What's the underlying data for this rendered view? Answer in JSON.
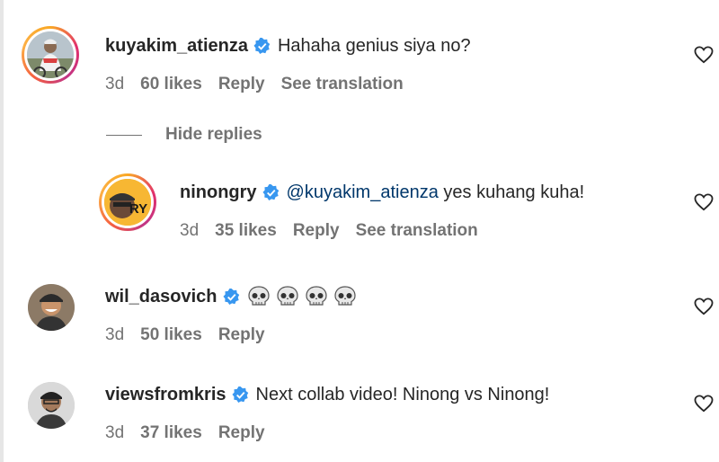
{
  "comments": [
    {
      "username": "kuyakim_atienza",
      "text": "Hahaha genius siya no?",
      "time": "3d",
      "likes": "60 likes",
      "reply": "Reply",
      "translation": "See translation"
    },
    {
      "username": "ninongry",
      "mention": "@kuyakim_atienza",
      "text": " yes kuhang kuha!",
      "time": "3d",
      "likes": "35 likes",
      "reply": "Reply",
      "translation": "See translation",
      "avatar_text": "RY"
    },
    {
      "username": "wil_dasovich",
      "text_icons": [
        "skull-icon",
        "skull-icon",
        "skull-icon",
        "skull-icon"
      ],
      "time": "3d",
      "likes": "50 likes",
      "reply": "Reply"
    },
    {
      "username": "viewsfromkris",
      "text": "Next collab video! Ninong vs Ninong!",
      "time": "3d",
      "likes": "37 likes",
      "reply": "Reply"
    }
  ],
  "hide_replies": "Hide replies",
  "colors": {
    "verified": "#3897f0",
    "meta": "#737373",
    "text": "#262626",
    "mention": "#00376b"
  }
}
